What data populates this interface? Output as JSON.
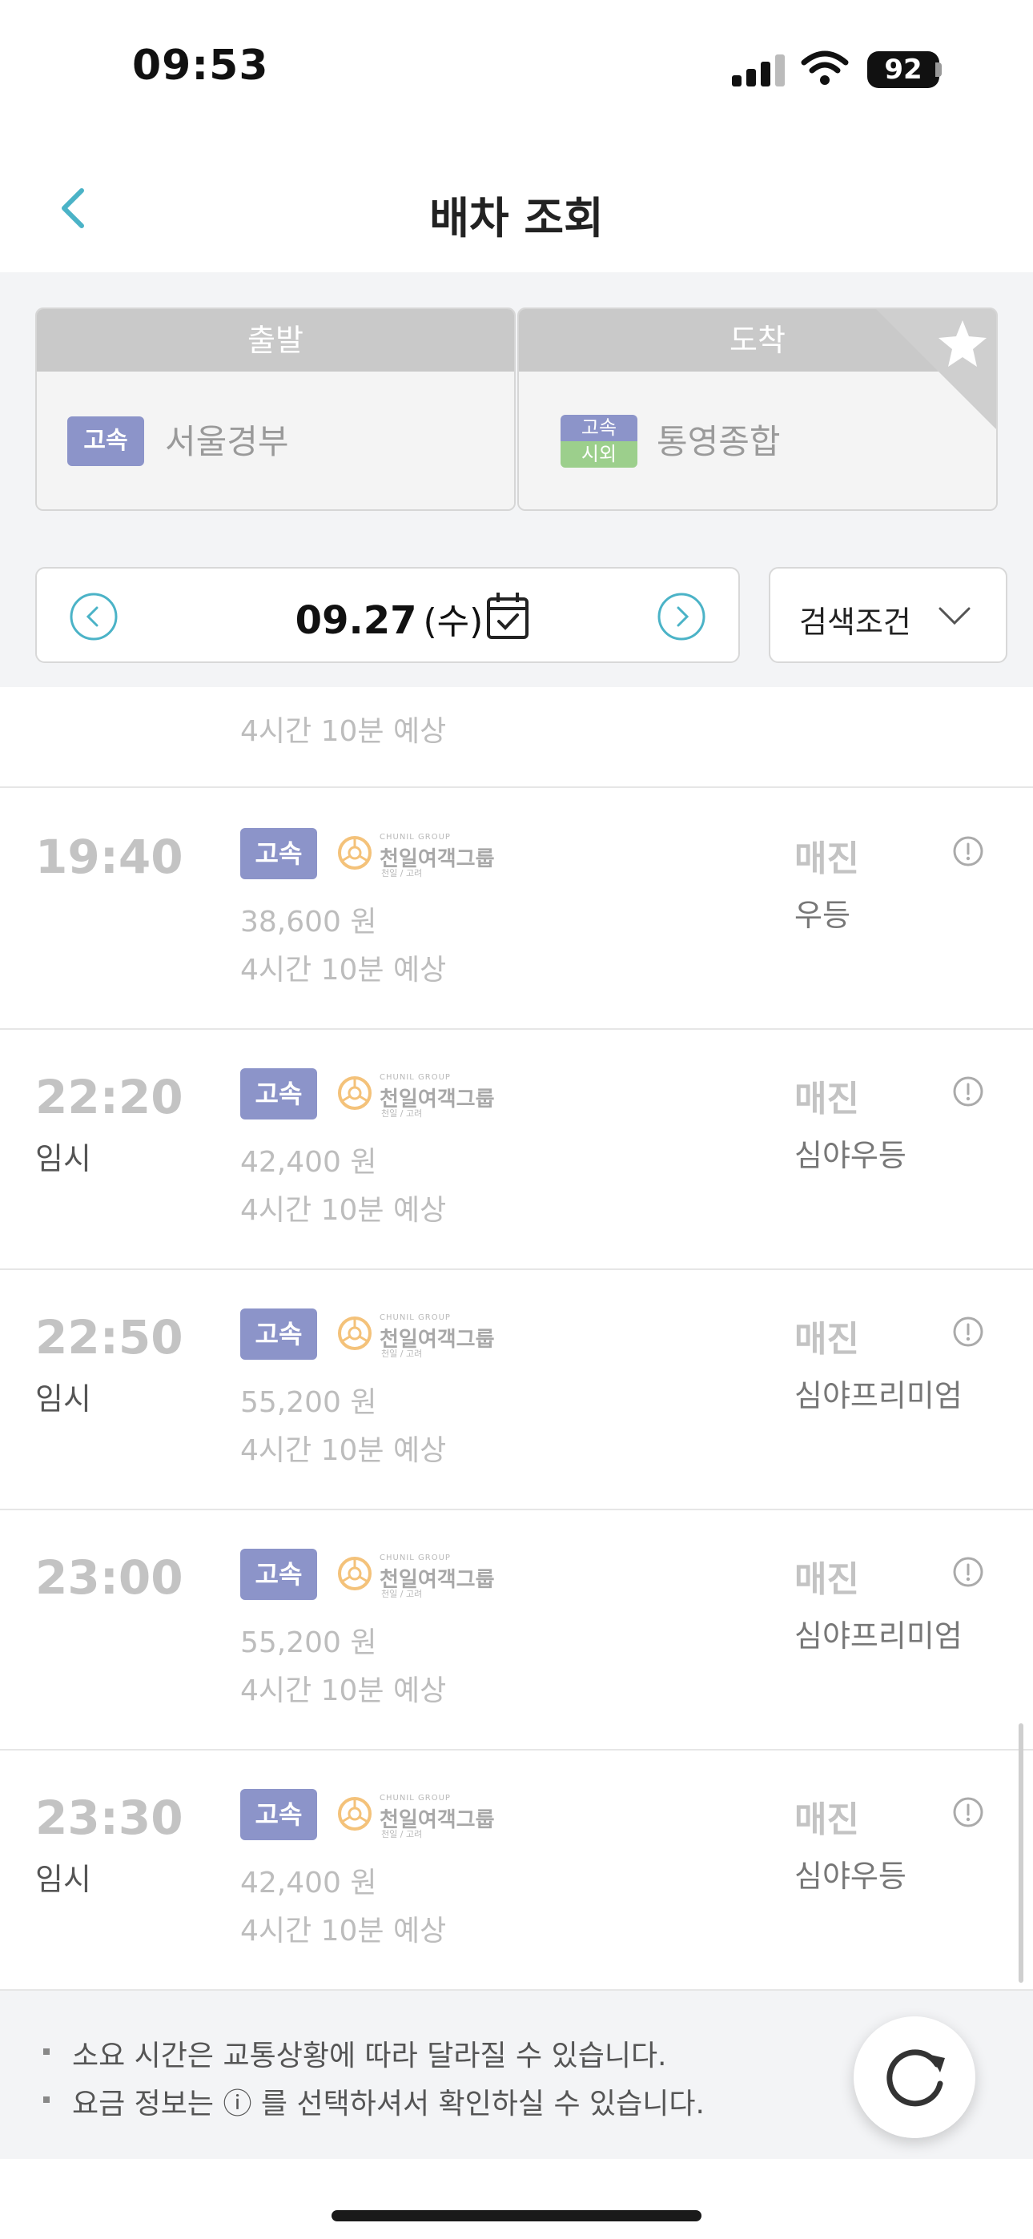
{
  "status_bar": {
    "time": "09:53",
    "battery": "92"
  },
  "header": {
    "title": "배차 조회"
  },
  "route": {
    "departure_label": "출발",
    "arrival_label": "도착",
    "departure_badge": "고속",
    "departure_terminal": "서울경부",
    "arrival_badge_top": "고속",
    "arrival_badge_bottom": "시외",
    "arrival_terminal": "통영종합"
  },
  "date_bar": {
    "date": "09.27",
    "day_of_week": "(수)",
    "filter_label": "검색조건"
  },
  "partial_row": {
    "duration": "4시간 10분 예상"
  },
  "schedules": [
    {
      "time": "19:40",
      "temp": "",
      "type": "고속",
      "fare": "38,600 원",
      "duration": "4시간 10분 예상",
      "status": "매진",
      "grade": "우등"
    },
    {
      "time": "22:20",
      "temp": "임시",
      "type": "고속",
      "fare": "42,400 원",
      "duration": "4시간 10분 예상",
      "status": "매진",
      "grade": "심야우등"
    },
    {
      "time": "22:50",
      "temp": "임시",
      "type": "고속",
      "fare": "55,200 원",
      "duration": "4시간 10분 예상",
      "status": "매진",
      "grade": "심야프리미엄"
    },
    {
      "time": "23:00",
      "temp": "",
      "type": "고속",
      "fare": "55,200 원",
      "duration": "4시간 10분 예상",
      "status": "매진",
      "grade": "심야프리미엄"
    },
    {
      "time": "23:30",
      "temp": "임시",
      "type": "고속",
      "fare": "42,400 원",
      "duration": "4시간 10분 예상",
      "status": "매진",
      "grade": "심야우등"
    }
  ],
  "company": {
    "name_ko": "천일여객그룹",
    "name_en": "CHUNIL GROUP",
    "sub": "천일 / 고려"
  },
  "footer": {
    "note1": "소요 시간은 교통상황에 따라 달라질 수 있습니다.",
    "note2": "요금 정보는 ⓘ 를 선택하셔서 확인하실 수 있습니다."
  },
  "colors": {
    "accent": "#4bb3c7",
    "badge_express": "#8c94c9",
    "badge_intercity": "#9ccf8c"
  }
}
